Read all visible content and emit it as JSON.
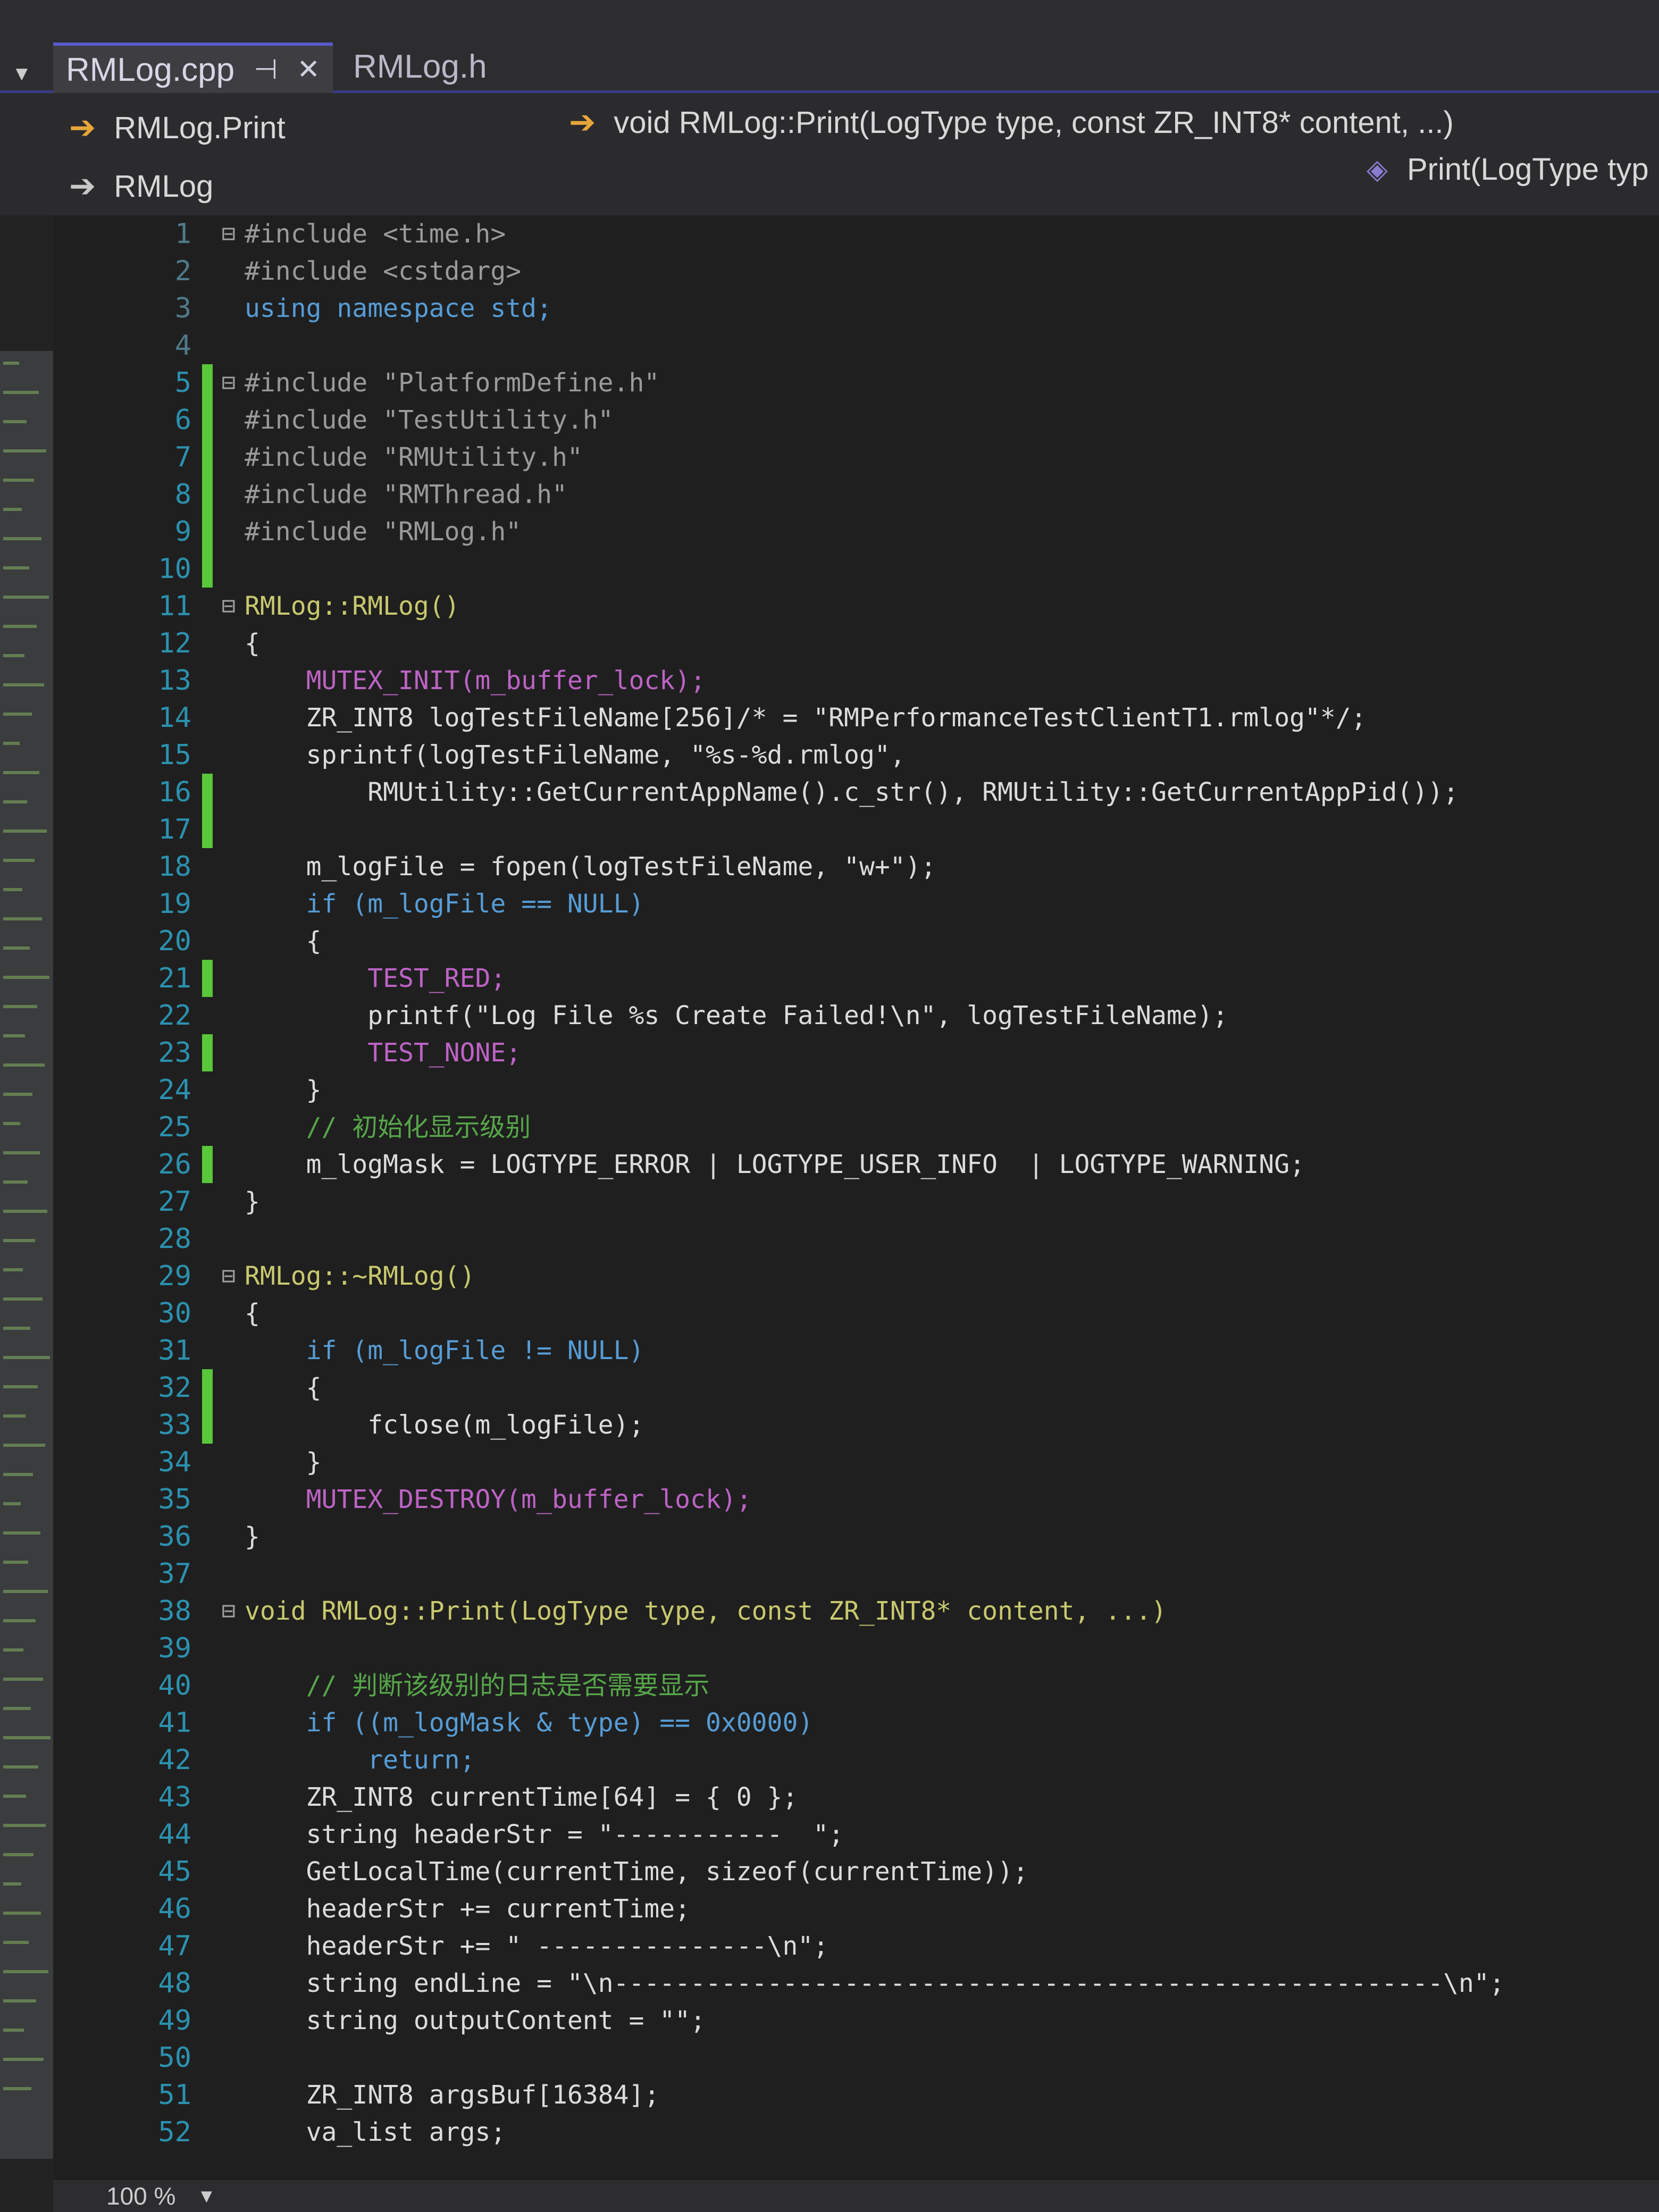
{
  "tabs": [
    {
      "label": "RMLog.cpp",
      "pin_icon": "pin-icon",
      "close_icon": "close-icon"
    },
    {
      "label": "RMLog.h"
    }
  ],
  "nav": {
    "scope": "RMLog.Print",
    "member": "void RMLog::Print(LogType type, const ZR_INT8* content, ...)",
    "class_name": "RMLog",
    "overload": "Print(LogType typ"
  },
  "code": [
    {
      "n": "1",
      "t": "#include <time.h>"
    },
    {
      "n": "2",
      "t": "#include <cstdarg>"
    },
    {
      "n": "3",
      "t": "using namespace std;"
    },
    {
      "n": "4",
      "t": ""
    },
    {
      "n": "5",
      "t": "#include \"PlatformDefine.h\""
    },
    {
      "n": "6",
      "t": "#include \"TestUtility.h\""
    },
    {
      "n": "7",
      "t": "#include \"RMUtility.h\""
    },
    {
      "n": "8",
      "t": "#include \"RMThread.h\""
    },
    {
      "n": "9",
      "t": "#include \"RMLog.h\""
    },
    {
      "n": "10",
      "t": ""
    },
    {
      "n": "11",
      "t": "RMLog::RMLog()"
    },
    {
      "n": "12",
      "t": "{"
    },
    {
      "n": "13",
      "t": "    MUTEX_INIT(m_buffer_lock);"
    },
    {
      "n": "14",
      "t": "    ZR_INT8 logTestFileName[256]/* = \"RMPerformanceTestClientT1.rmlog\"*/;"
    },
    {
      "n": "15",
      "t": "    sprintf(logTestFileName, \"%s-%d.rmlog\","
    },
    {
      "n": "16",
      "t": "        RMUtility::GetCurrentAppName().c_str(), RMUtility::GetCurrentAppPid());"
    },
    {
      "n": "17",
      "t": ""
    },
    {
      "n": "18",
      "t": "    m_logFile = fopen(logTestFileName, \"w+\");"
    },
    {
      "n": "19",
      "t": "    if (m_logFile == NULL)"
    },
    {
      "n": "20",
      "t": "    {"
    },
    {
      "n": "21",
      "t": "        TEST_RED;"
    },
    {
      "n": "22",
      "t": "        printf(\"Log File %s Create Failed!\\n\", logTestFileName);"
    },
    {
      "n": "23",
      "t": "        TEST_NONE;"
    },
    {
      "n": "24",
      "t": "    }"
    },
    {
      "n": "25",
      "t": "    // 初始化显示级别"
    },
    {
      "n": "26",
      "t": "    m_logMask = LOGTYPE_ERROR | LOGTYPE_USER_INFO  | LOGTYPE_WARNING;"
    },
    {
      "n": "27",
      "t": "}"
    },
    {
      "n": "28",
      "t": ""
    },
    {
      "n": "29",
      "t": "RMLog::~RMLog()"
    },
    {
      "n": "30",
      "t": "{"
    },
    {
      "n": "31",
      "t": "    if (m_logFile != NULL)"
    },
    {
      "n": "32",
      "t": "    {"
    },
    {
      "n": "33",
      "t": "        fclose(m_logFile);"
    },
    {
      "n": "34",
      "t": "    }"
    },
    {
      "n": "35",
      "t": "    MUTEX_DESTROY(m_buffer_lock);"
    },
    {
      "n": "36",
      "t": "}"
    },
    {
      "n": "37",
      "t": ""
    },
    {
      "n": "38",
      "t": "void RMLog::Print(LogType type, const ZR_INT8* content, ...)"
    },
    {
      "n": "39",
      "t": ""
    },
    {
      "n": "40",
      "t": "    // 判断该级别的日志是否需要显示"
    },
    {
      "n": "41",
      "t": "    if ((m_logMask & type) == 0x0000)"
    },
    {
      "n": "42",
      "t": "        return;"
    },
    {
      "n": "43",
      "t": "    ZR_INT8 currentTime[64] = { 0 };"
    },
    {
      "n": "44",
      "t": "    string headerStr = \"-----------  \";"
    },
    {
      "n": "45",
      "t": "    GetLocalTime(currentTime, sizeof(currentTime));"
    },
    {
      "n": "46",
      "t": "    headerStr += currentTime;"
    },
    {
      "n": "47",
      "t": "    headerStr += \" ---------------\\n\";"
    },
    {
      "n": "48",
      "t": "    string endLine = \"\\n------------------------------------------------------\\n\";"
    },
    {
      "n": "49",
      "t": "    string outputContent = \"\";"
    },
    {
      "n": "50",
      "t": ""
    },
    {
      "n": "51",
      "t": "    ZR_INT8 argsBuf[16384];"
    },
    {
      "n": "52",
      "t": "    va_list args;"
    }
  ],
  "status": {
    "zoom": "100 %"
  }
}
